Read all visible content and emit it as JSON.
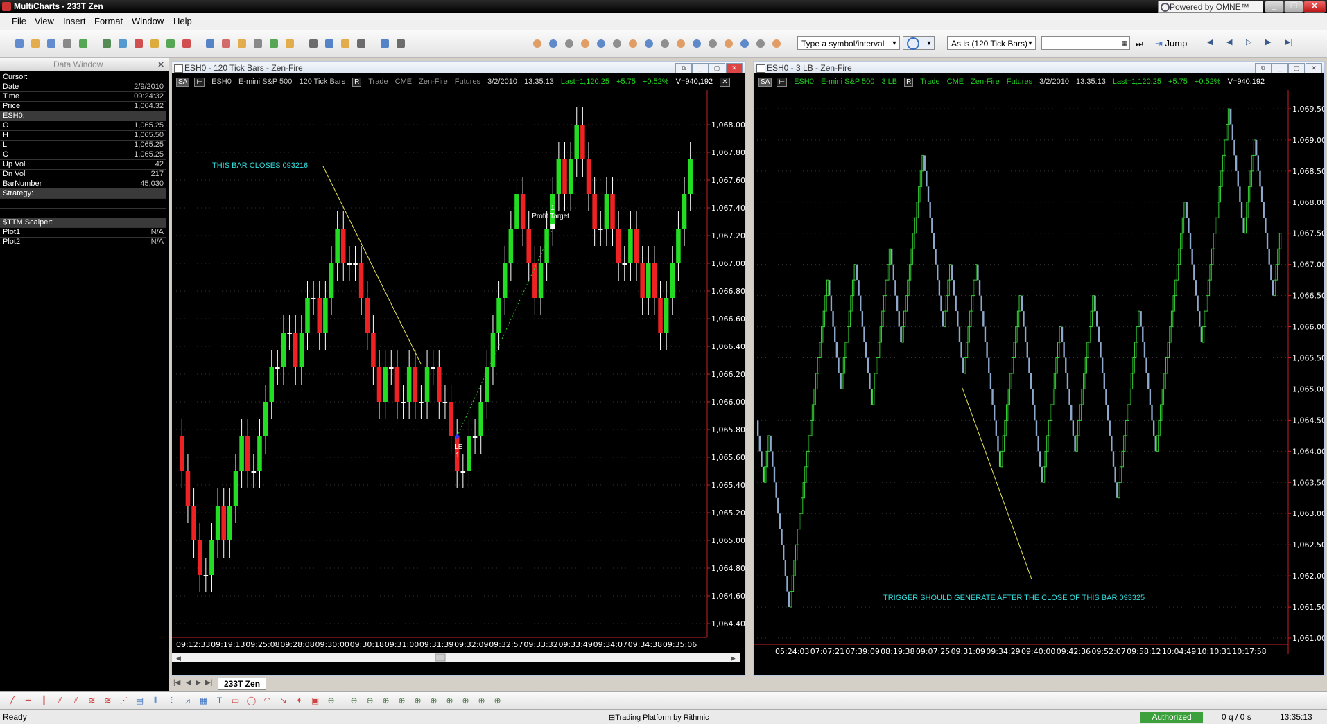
{
  "app": {
    "title": "MultiCharts - 233T Zen",
    "powered_by": "Powered by OMNE™"
  },
  "menu": [
    "File",
    "View",
    "Insert",
    "Format",
    "Window",
    "Help"
  ],
  "toolbar": {
    "symbol_placeholder": "Type a symbol/interval",
    "resolution": "As is (120 Tick Bars)",
    "jump_label": "Jump"
  },
  "data_window": {
    "title": "Data Window",
    "rows": [
      {
        "label": "Cursor:",
        "value": "",
        "header": false
      },
      {
        "label": "Date",
        "value": "2/9/2010",
        "header": false
      },
      {
        "label": "Time",
        "value": "09:24:32",
        "header": false
      },
      {
        "label": "Price",
        "value": "1,064.32",
        "header": false
      },
      {
        "label": "ESH0:",
        "value": "",
        "header": true
      },
      {
        "label": "O",
        "value": "1,065.25",
        "header": false
      },
      {
        "label": "H",
        "value": "1,065.50",
        "header": false
      },
      {
        "label": "L",
        "value": "1,065.25",
        "header": false
      },
      {
        "label": "C",
        "value": "1,065.25",
        "header": false
      },
      {
        "label": "Up Vol",
        "value": "42",
        "header": false
      },
      {
        "label": "Dn Vol",
        "value": "217",
        "header": false
      },
      {
        "label": "BarNumber",
        "value": "45,030",
        "header": false
      },
      {
        "label": "Strategy:",
        "value": "",
        "header": true
      },
      {
        "label": "",
        "value": "",
        "header": false
      },
      {
        "label": "",
        "value": "",
        "header": false
      },
      {
        "label": "$TTM Scalper:",
        "value": "",
        "header": true
      },
      {
        "label": "Plot1",
        "value": "N/A",
        "header": false
      },
      {
        "label": "Plot2",
        "value": "N/A",
        "header": false
      }
    ]
  },
  "chart_left": {
    "window_title": "ESH0 - 120 Tick Bars - Zen-Fire",
    "info": {
      "badge": "SA",
      "symbol": "ESH0",
      "description": "E-mini S&P 500",
      "interval": "120 Tick Bars",
      "mode": "Trade",
      "exchange": "CME",
      "feed": "Zen-Fire",
      "category": "Futures",
      "date": "3/2/2010",
      "time": "13:35:13",
      "last": "Last=1,120.25",
      "change": "+5.75",
      "pct": "+0.52%",
      "volume": "V=940,192"
    },
    "annotation": "THIS BAR CLOSES 093216",
    "entry_label": "LE",
    "entry_qty": "1",
    "exit_label": "Profit Target",
    "exit_qty": "1",
    "colors": {
      "up": "#22dd22",
      "down": "#ee2222",
      "neutral": "#ffffff",
      "annotation": "#33dddd",
      "trendline": "#e8e85a"
    }
  },
  "chart_right": {
    "window_title": "ESH0 - 3 LB - Zen-Fire",
    "info": {
      "badge": "SA",
      "symbol": "ESH0",
      "description": "E-mini S&P 500",
      "interval": "3 LB",
      "mode": "Trade",
      "exchange": "CME",
      "feed": "Zen-Fire",
      "category": "Futures",
      "date": "3/2/2010",
      "time": "13:35:13",
      "last": "Last=1,120.25",
      "change": "+5.75",
      "pct": "+0.52%",
      "volume": "V=940,192"
    },
    "annotation": "TRIGGER SHOULD GENERATE AFTER THE CLOSE OF THIS BAR 093325",
    "colors": {
      "up": "#33cc33",
      "down": "#8ea8cc",
      "annotation": "#33dddd",
      "trendline": "#e8e85a"
    }
  },
  "chart_data": [
    {
      "type": "candlestick",
      "title": "ESH0 - 120 Tick Bars - Zen-Fire",
      "ylim": [
        1064.3,
        1068.25
      ],
      "y_ticks": [
        "1,068.00",
        "1,067.80",
        "1,067.60",
        "1,067.40",
        "1,067.20",
        "1,067.00",
        "1,066.80",
        "1,066.60",
        "1,066.40",
        "1,066.20",
        "1,066.00",
        "1,065.80",
        "1,065.60",
        "1,065.40",
        "1,065.20",
        "1,065.00",
        "1,064.80",
        "1,064.60",
        "1,064.40"
      ],
      "x_ticks": [
        "09:12:33",
        "09:19:13",
        "09:25:08",
        "09:28:08",
        "09:30:00",
        "09:30:18",
        "09:31:00",
        "09:31:39",
        "09:32:09",
        "09:32:57",
        "09:33:32",
        "09:33:49",
        "09:34:07",
        "09:34:38",
        "09:35:06"
      ],
      "closes": [
        1065.5,
        1065.25,
        1065.0,
        1064.75,
        1064.75,
        1065.0,
        1065.25,
        1065.0,
        1065.25,
        1065.5,
        1065.75,
        1065.5,
        1065.5,
        1065.75,
        1066.0,
        1066.25,
        1066.25,
        1066.5,
        1066.5,
        1066.25,
        1066.5,
        1066.75,
        1066.75,
        1066.5,
        1066.75,
        1067.0,
        1067.25,
        1067.0,
        1067.0,
        1067.0,
        1066.75,
        1066.5,
        1066.25,
        1066.0,
        1066.25,
        1066.25,
        1066.0,
        1066.0,
        1066.25,
        1066.0,
        1066.0,
        1066.25,
        1066.25,
        1066.0,
        1066.0,
        1065.75,
        1065.5,
        1065.5,
        1065.75,
        1065.75,
        1066.0,
        1066.25,
        1066.5,
        1066.75,
        1067.0,
        1067.25,
        1067.5,
        1067.25,
        1067.0,
        1066.75,
        1067.0,
        1067.25,
        1067.5,
        1067.75,
        1067.5,
        1067.75,
        1068.0,
        1067.75,
        1067.5,
        1067.25,
        1067.25,
        1067.5,
        1067.25,
        1067.0,
        1067.0,
        1067.25,
        1067.0,
        1066.75,
        1067.0,
        1066.75,
        1066.5,
        1066.75,
        1067.0,
        1067.25,
        1067.5,
        1067.75
      ],
      "entry": {
        "label": "LE",
        "price": 1065.75
      },
      "exit": {
        "label": "Profit Target",
        "price": 1067.25
      }
    },
    {
      "type": "line-break",
      "title": "ESH0 - 3 LB - Zen-Fire",
      "ylim": [
        1060.9,
        1069.8
      ],
      "y_ticks": [
        "1,069.50",
        "1,069.00",
        "1,068.50",
        "1,068.00",
        "1,067.50",
        "1,067.00",
        "1,066.50",
        "1,066.00",
        "1,065.50",
        "1,065.00",
        "1,064.50",
        "1,064.00",
        "1,063.50",
        "1,063.00",
        "1,062.50",
        "1,062.00",
        "1,061.50",
        "1,061.00"
      ],
      "x_ticks": [
        "05:24:03",
        "07:07:21",
        "07:39:09",
        "08:19:38",
        "09:07:25",
        "09:31:09",
        "09:34:29",
        "09:40:00",
        "09:42:36",
        "09:52:07",
        "09:58:12",
        "10:04:49",
        "10:10:31",
        "10:17:58"
      ],
      "turning_points": [
        1064.5,
        1063.5,
        1064.25,
        1063.0,
        1061.5,
        1064.5,
        1066.75,
        1065.0,
        1067.0,
        1064.75,
        1067.25,
        1065.75,
        1068.75,
        1066.0,
        1067.0,
        1065.25,
        1067.0,
        1063.75,
        1066.5,
        1063.5,
        1066.0,
        1064.0,
        1066.5,
        1063.25,
        1066.25,
        1064.0,
        1068.0,
        1065.75,
        1069.5,
        1067.5,
        1069.0,
        1066.5,
        1067.5
      ]
    }
  ],
  "tabs": [
    "233T Zen"
  ],
  "status": {
    "ready": "Ready",
    "provider": "Trading Platform by Rithmic",
    "authorized": "Authorized",
    "queue": "0 q / 0 s",
    "clock": "13:35:13"
  }
}
